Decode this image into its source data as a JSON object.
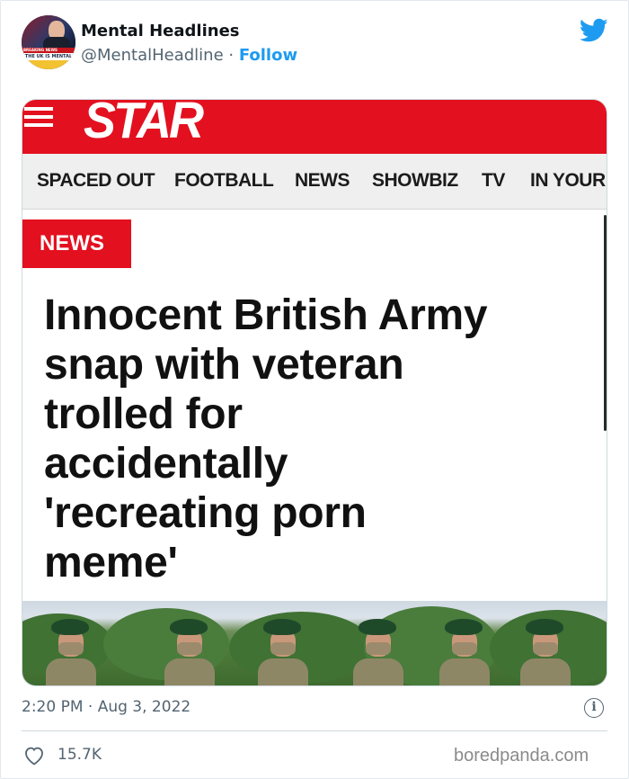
{
  "tweet": {
    "author": {
      "name": "Mental Headlines",
      "handle": "@MentalHeadline",
      "separator": " · ",
      "follow_label": "Follow",
      "avatar_caption_top": "BREAKING NEWS",
      "avatar_caption": "THE UK IS MENTAL"
    },
    "timestamp": "2:20 PM · Aug 3, 2022",
    "info_icon": "i",
    "likes": "15.7K",
    "icons": [
      "twitter-bird-icon",
      "info-icon",
      "heart-icon"
    ],
    "colors": {
      "accent": "#1d9bf0",
      "muted": "#536471"
    }
  },
  "article": {
    "logo": "STAR",
    "nav": [
      "SPACED OUT",
      "FOOTBALL",
      "NEWS",
      "SHOWBIZ",
      "TV",
      "IN YOUR"
    ],
    "section_tag": "NEWS",
    "headline_lines": [
      "Innocent British Army",
      "snap with veteran",
      "trolled for",
      "accidentally",
      "'recreating porn",
      "meme'"
    ],
    "colors": {
      "brand_red": "#e3101f"
    }
  },
  "watermark": "boredpanda.com"
}
